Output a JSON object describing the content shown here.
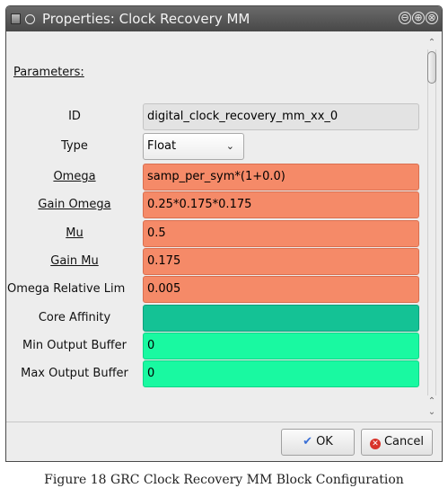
{
  "window": {
    "title": "Properties: Clock Recovery MM",
    "controls": [
      "⊖",
      "⊕",
      "⊗"
    ]
  },
  "parameters_heading": "Parameters:",
  "rows": [
    {
      "label": "ID",
      "value": "digital_clock_recovery_mm_xx_0",
      "style": "readonly"
    },
    {
      "label": "Type",
      "value": "Float",
      "style": "select"
    },
    {
      "label": "Omega",
      "value": "samp_per_sym*(1+0.0)",
      "style": "orange"
    },
    {
      "label": "Gain Omega",
      "value": "0.25*0.175*0.175",
      "style": "orange"
    },
    {
      "label": "Mu",
      "value": "0.5",
      "style": "orange"
    },
    {
      "label": "Gain Mu",
      "value": "0.175",
      "style": "orange"
    },
    {
      "label": "Omega Relative Lim",
      "value": "0.005",
      "style": "orange"
    },
    {
      "label": "Core Affinity",
      "value": "",
      "style": "teal"
    },
    {
      "label": "Min Output Buffer",
      "value": "0",
      "style": "green"
    },
    {
      "label": "Max Output Buffer",
      "value": "0",
      "style": "green"
    }
  ],
  "buttons": {
    "ok_label": "OK",
    "cancel_label": "Cancel"
  },
  "caption": "Figure 18 GRC Clock Recovery MM Block Configuration",
  "colors": {
    "orange_field": "#f58a68",
    "teal_field": "#14c295",
    "green_field": "#19f9a1",
    "titlebar": "#555555"
  }
}
